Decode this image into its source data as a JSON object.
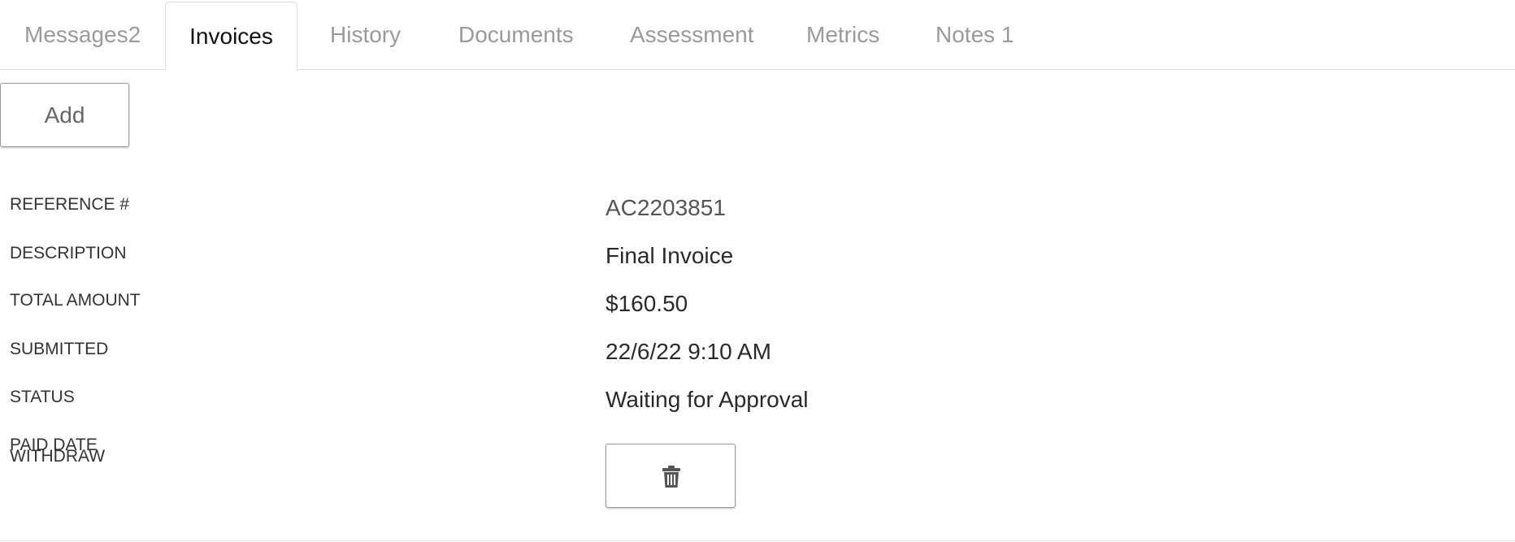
{
  "tabs": [
    {
      "label": "Messages2",
      "active": false
    },
    {
      "label": "Invoices",
      "active": true
    },
    {
      "label": "History",
      "active": false
    },
    {
      "label": "Documents",
      "active": false
    },
    {
      "label": "Assessment",
      "active": false
    },
    {
      "label": "Metrics",
      "active": false
    },
    {
      "label": "Notes 1",
      "active": false
    }
  ],
  "actions": {
    "add_label": "Add"
  },
  "invoice": {
    "labels": {
      "reference": "REFERENCE #",
      "description": "DESCRIPTION",
      "total_amount": "TOTAL AMOUNT",
      "submitted": "SUBMITTED",
      "status": "STATUS",
      "paid_date": "PAID DATE",
      "withdraw": "WITHDRAW"
    },
    "values": {
      "reference": "AC2203851",
      "description": "Final Invoice",
      "total_amount": "$160.50",
      "submitted": "22/6/22 9:10 AM",
      "status": "Waiting for Approval"
    },
    "withdraw_icon": "trash-icon"
  },
  "colors": {
    "active_tab_text": "#111111",
    "inactive_tab_text": "#9a9a9a",
    "border": "#dcdcdc"
  }
}
